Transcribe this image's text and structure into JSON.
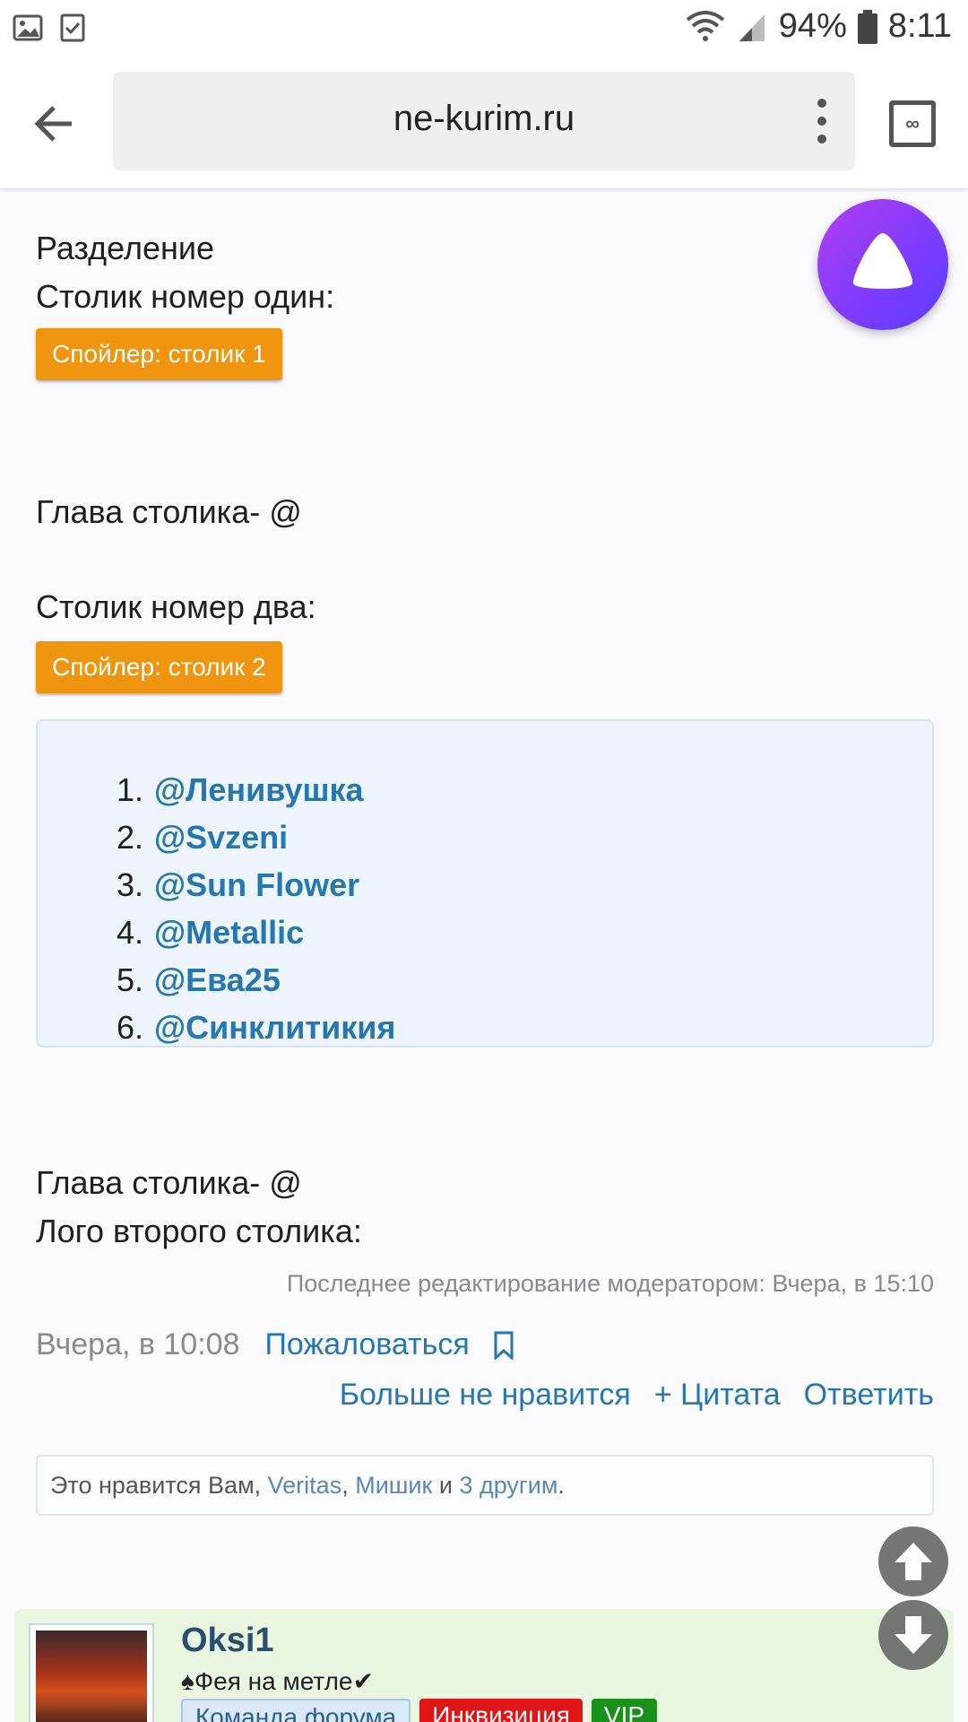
{
  "status_bar": {
    "battery": "94%",
    "time": "8:11"
  },
  "browser": {
    "url": "ne-kurim.ru",
    "tabs_icon": "∞"
  },
  "post_body": {
    "line1": "Разделение",
    "line2": "Столик номер один:",
    "spoiler1": "Спойлер: столик 1",
    "head1": "Глава столика- @",
    "line3": "Столик номер два:",
    "spoiler2": "Спойлер: столик 2",
    "list": [
      {
        "num": "1.",
        "name": "@Ленивушка"
      },
      {
        "num": "2.",
        "name": "@Svzeni"
      },
      {
        "num": "3.",
        "name": "@Sun Flower"
      },
      {
        "num": "4.",
        "name": "@Metallic"
      },
      {
        "num": "5.",
        "name": "@Ева25"
      },
      {
        "num": "6.",
        "name": "@Синклитикия"
      }
    ],
    "head2": "Глава столика- @",
    "logo_line": "Лого второго столика:"
  },
  "edit_note": "Последнее редактирование модератором: Вчера, в 15:10",
  "meta": {
    "date": "Вчера, в 10:08",
    "report": "Пожаловаться"
  },
  "actions": {
    "unlike": "Больше не нравится",
    "quote": "+ Цитата",
    "reply": "Ответить"
  },
  "likes": {
    "prefix": "Это нравится Вам, ",
    "user1": "Veritas",
    "sep": ", ",
    "user2": "Мишик",
    "and": " и ",
    "others": "3 другим",
    "end": "."
  },
  "next_post": {
    "username": "Oksi1",
    "title": "♠Фея на метле✔",
    "badges": [
      "Команда форума",
      "Инквизиция",
      "VIP"
    ]
  },
  "colors": {
    "link": "#2577b1",
    "spoiler": "#f0950f",
    "alice_gradient": "#b03ef0"
  }
}
